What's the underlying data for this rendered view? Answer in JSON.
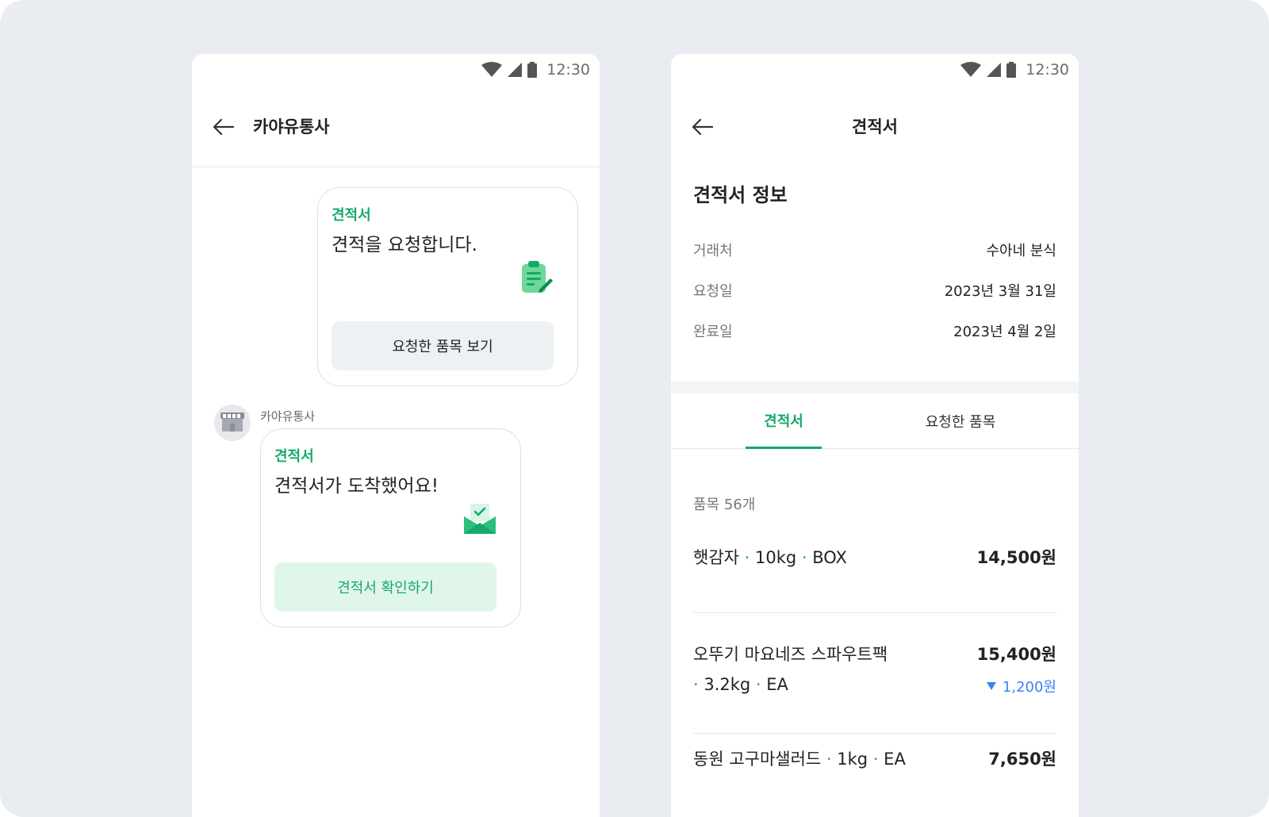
{
  "status_bar": {
    "time": "12:30"
  },
  "left_screen": {
    "title": "카야유통사",
    "messages": [
      {
        "tag": "견적서",
        "text": "견적을 요청합니다.",
        "icon": "clipboard-edit-icon",
        "button_label": "요청한 품목 보기"
      },
      {
        "sender": "카야유통사",
        "tag": "견적서",
        "text": "견적서가 도착했어요!",
        "icon": "envelope-check-icon",
        "button_label": "견적서 확인하기"
      }
    ]
  },
  "right_screen": {
    "title": "견적서",
    "section_title": "견적서 정보",
    "info": [
      {
        "label": "거래처",
        "value": "수아네 분식"
      },
      {
        "label": "요청일",
        "value": "2023년 3월 31일"
      },
      {
        "label": "완료일",
        "value": "2023년 4월 2일"
      }
    ],
    "tabs": [
      {
        "label": "견적서",
        "active": true
      },
      {
        "label": "요청한 품목",
        "active": false
      }
    ],
    "item_count": "품목 56개",
    "items": [
      {
        "name": "햇감자",
        "spec_1": "10kg",
        "spec_2": "BOX",
        "price": "14,500원"
      },
      {
        "name": "오뚜기 마요네즈 스파우트팩",
        "spec_1": "3.2kg",
        "spec_2": "EA",
        "price": "15,400원",
        "discount": "1,200원"
      },
      {
        "name": "동원 고구마샐러드",
        "spec_1": "1kg",
        "spec_2": "EA",
        "price": "7,650원"
      }
    ]
  },
  "colors": {
    "brand_green": "#14a86a",
    "discount_blue": "#3b82f6",
    "background": "#e9edf1"
  }
}
